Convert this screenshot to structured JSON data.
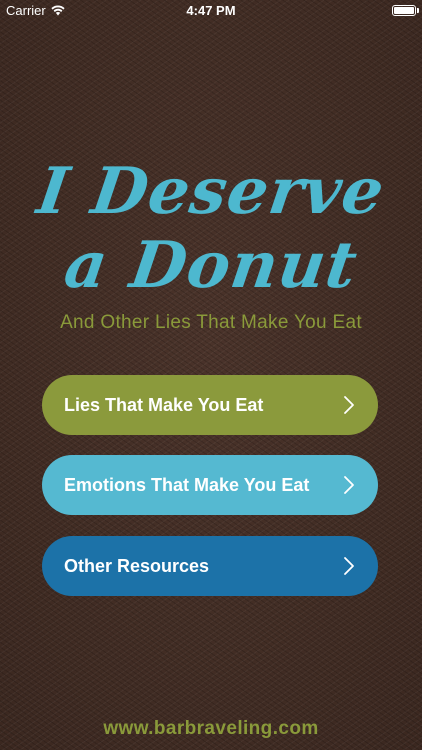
{
  "status_bar": {
    "carrier": "Carrier",
    "time": "4:47 PM",
    "battery_level": 1.0
  },
  "title": {
    "line1": "I Deserve",
    "line2": "a Donut"
  },
  "subtitle": "And Other Lies That Make You Eat",
  "menu": {
    "items": [
      {
        "label": "Lies That Make You Eat",
        "color": "#8b9a3c",
        "icon": "chevron-right-icon"
      },
      {
        "label": "Emotions That Make You Eat",
        "color": "#55b9d1",
        "icon": "chevron-right-icon"
      },
      {
        "label": "Other Resources",
        "color": "#1c72a8",
        "icon": "chevron-right-icon"
      }
    ]
  },
  "footer": {
    "link": "www.barbraveling.com"
  },
  "colors": {
    "background": "#3f2b23",
    "title": "#4db8cf",
    "accent_green": "#8a9a3a"
  }
}
